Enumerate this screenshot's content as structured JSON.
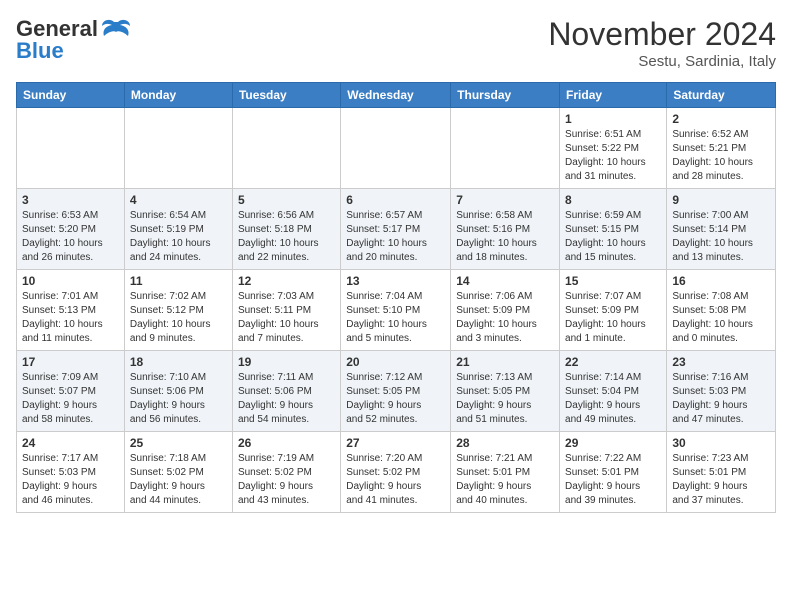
{
  "header": {
    "logo_general": "General",
    "logo_blue": "Blue",
    "month": "November 2024",
    "location": "Sestu, Sardinia, Italy"
  },
  "weekdays": [
    "Sunday",
    "Monday",
    "Tuesday",
    "Wednesday",
    "Thursday",
    "Friday",
    "Saturday"
  ],
  "weeks": [
    [
      {
        "day": "",
        "content": ""
      },
      {
        "day": "",
        "content": ""
      },
      {
        "day": "",
        "content": ""
      },
      {
        "day": "",
        "content": ""
      },
      {
        "day": "",
        "content": ""
      },
      {
        "day": "1",
        "content": "Sunrise: 6:51 AM\nSunset: 5:22 PM\nDaylight: 10 hours\nand 31 minutes."
      },
      {
        "day": "2",
        "content": "Sunrise: 6:52 AM\nSunset: 5:21 PM\nDaylight: 10 hours\nand 28 minutes."
      }
    ],
    [
      {
        "day": "3",
        "content": "Sunrise: 6:53 AM\nSunset: 5:20 PM\nDaylight: 10 hours\nand 26 minutes."
      },
      {
        "day": "4",
        "content": "Sunrise: 6:54 AM\nSunset: 5:19 PM\nDaylight: 10 hours\nand 24 minutes."
      },
      {
        "day": "5",
        "content": "Sunrise: 6:56 AM\nSunset: 5:18 PM\nDaylight: 10 hours\nand 22 minutes."
      },
      {
        "day": "6",
        "content": "Sunrise: 6:57 AM\nSunset: 5:17 PM\nDaylight: 10 hours\nand 20 minutes."
      },
      {
        "day": "7",
        "content": "Sunrise: 6:58 AM\nSunset: 5:16 PM\nDaylight: 10 hours\nand 18 minutes."
      },
      {
        "day": "8",
        "content": "Sunrise: 6:59 AM\nSunset: 5:15 PM\nDaylight: 10 hours\nand 15 minutes."
      },
      {
        "day": "9",
        "content": "Sunrise: 7:00 AM\nSunset: 5:14 PM\nDaylight: 10 hours\nand 13 minutes."
      }
    ],
    [
      {
        "day": "10",
        "content": "Sunrise: 7:01 AM\nSunset: 5:13 PM\nDaylight: 10 hours\nand 11 minutes."
      },
      {
        "day": "11",
        "content": "Sunrise: 7:02 AM\nSunset: 5:12 PM\nDaylight: 10 hours\nand 9 minutes."
      },
      {
        "day": "12",
        "content": "Sunrise: 7:03 AM\nSunset: 5:11 PM\nDaylight: 10 hours\nand 7 minutes."
      },
      {
        "day": "13",
        "content": "Sunrise: 7:04 AM\nSunset: 5:10 PM\nDaylight: 10 hours\nand 5 minutes."
      },
      {
        "day": "14",
        "content": "Sunrise: 7:06 AM\nSunset: 5:09 PM\nDaylight: 10 hours\nand 3 minutes."
      },
      {
        "day": "15",
        "content": "Sunrise: 7:07 AM\nSunset: 5:09 PM\nDaylight: 10 hours\nand 1 minute."
      },
      {
        "day": "16",
        "content": "Sunrise: 7:08 AM\nSunset: 5:08 PM\nDaylight: 10 hours\nand 0 minutes."
      }
    ],
    [
      {
        "day": "17",
        "content": "Sunrise: 7:09 AM\nSunset: 5:07 PM\nDaylight: 9 hours\nand 58 minutes."
      },
      {
        "day": "18",
        "content": "Sunrise: 7:10 AM\nSunset: 5:06 PM\nDaylight: 9 hours\nand 56 minutes."
      },
      {
        "day": "19",
        "content": "Sunrise: 7:11 AM\nSunset: 5:06 PM\nDaylight: 9 hours\nand 54 minutes."
      },
      {
        "day": "20",
        "content": "Sunrise: 7:12 AM\nSunset: 5:05 PM\nDaylight: 9 hours\nand 52 minutes."
      },
      {
        "day": "21",
        "content": "Sunrise: 7:13 AM\nSunset: 5:05 PM\nDaylight: 9 hours\nand 51 minutes."
      },
      {
        "day": "22",
        "content": "Sunrise: 7:14 AM\nSunset: 5:04 PM\nDaylight: 9 hours\nand 49 minutes."
      },
      {
        "day": "23",
        "content": "Sunrise: 7:16 AM\nSunset: 5:03 PM\nDaylight: 9 hours\nand 47 minutes."
      }
    ],
    [
      {
        "day": "24",
        "content": "Sunrise: 7:17 AM\nSunset: 5:03 PM\nDaylight: 9 hours\nand 46 minutes."
      },
      {
        "day": "25",
        "content": "Sunrise: 7:18 AM\nSunset: 5:02 PM\nDaylight: 9 hours\nand 44 minutes."
      },
      {
        "day": "26",
        "content": "Sunrise: 7:19 AM\nSunset: 5:02 PM\nDaylight: 9 hours\nand 43 minutes."
      },
      {
        "day": "27",
        "content": "Sunrise: 7:20 AM\nSunset: 5:02 PM\nDaylight: 9 hours\nand 41 minutes."
      },
      {
        "day": "28",
        "content": "Sunrise: 7:21 AM\nSunset: 5:01 PM\nDaylight: 9 hours\nand 40 minutes."
      },
      {
        "day": "29",
        "content": "Sunrise: 7:22 AM\nSunset: 5:01 PM\nDaylight: 9 hours\nand 39 minutes."
      },
      {
        "day": "30",
        "content": "Sunrise: 7:23 AM\nSunset: 5:01 PM\nDaylight: 9 hours\nand 37 minutes."
      }
    ]
  ]
}
